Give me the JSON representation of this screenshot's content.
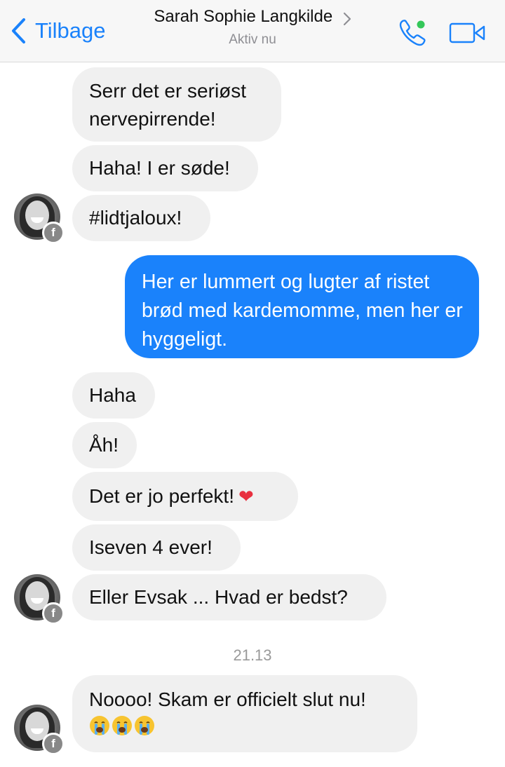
{
  "header": {
    "back_label": "Tilbage",
    "contact_name": "Sarah Sophie Langkilde",
    "status": "Aktiv nu",
    "icons": [
      "chevron-left-icon",
      "chevron-right-icon",
      "phone-icon",
      "video-camera-icon"
    ],
    "accent_color": "#1a82fb",
    "online_color": "#34c759"
  },
  "messages": {
    "m1": "Serr det er seriøst",
    "m1b": "nervepirrende!",
    "m2": "Haha! I er søde!",
    "m3": "#lidtjaloux!",
    "m4": "Her er lummert og lugter af ristet brød med kardemomme, men her er hyggeligt.",
    "m5": "Haha",
    "m6": "Åh!",
    "m7": "Det er jo perfekt!",
    "m7_emoji": "❤",
    "m8": "Iseven 4 ever!",
    "m9": "Eller Evsak ... Hvad er bedst?",
    "time": "21.13",
    "m10": "Noooo! Skam er officielt slut nu!"
  },
  "avatar": {
    "badge": "f"
  },
  "colors": {
    "incoming_bubble": "#f0f0f0",
    "outgoing_bubble": "#1a82fb"
  }
}
